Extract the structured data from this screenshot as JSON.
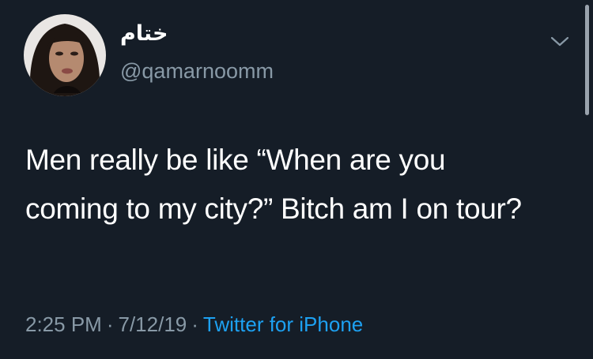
{
  "tweet": {
    "display_name": "ختام",
    "handle": "@qamarnoomm",
    "text": "Men really be like “When are you coming to my city?” Bitch am I on tour?",
    "time": "2:25 PM",
    "date": "7/12/19",
    "separator": "·",
    "source": "Twitter for iPhone"
  },
  "icons": {
    "menu": "chevron-down-icon",
    "avatar": "avatar"
  },
  "colors": {
    "background": "#151d27",
    "secondary_text": "#8899a6",
    "link": "#1da1f2"
  }
}
